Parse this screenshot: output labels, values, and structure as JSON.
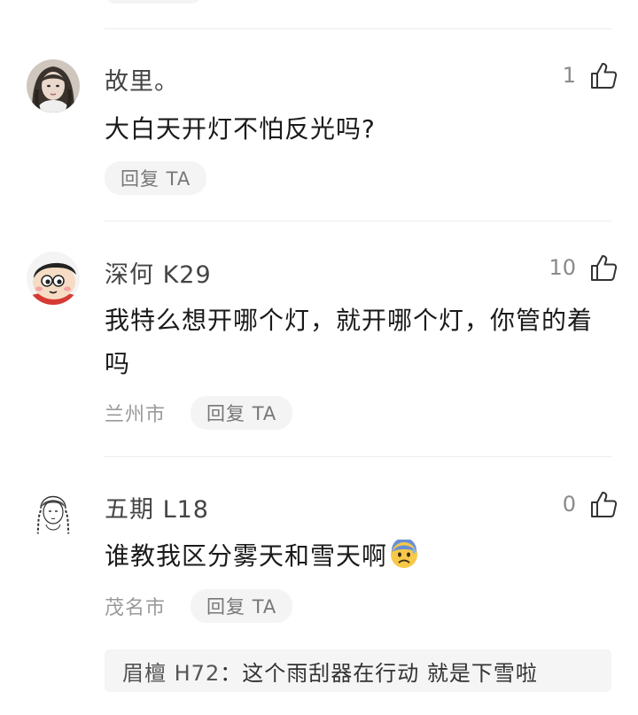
{
  "comments": [
    {
      "username": "故里。",
      "likes": "1",
      "text": "大白天开灯不怕反光吗?",
      "location": "",
      "reply_label": "回复 TA",
      "avatar": "girl-photo-avatar"
    },
    {
      "username": "深何 K29",
      "likes": "10",
      "text": "我特么想开哪个灯，就开哪个灯，你管的着吗",
      "location": "兰州市",
      "reply_label": "回复 TA",
      "avatar": "cartoon-boy-avatar"
    },
    {
      "username": "五期 L18",
      "likes": "0",
      "text": "谁教我区分雾天和雪天啊",
      "emoji": "anxious-sweat-face-emoji",
      "location": "茂名市",
      "reply_label": "回复 TA",
      "avatar": "sketch-girl-avatar"
    }
  ],
  "sub_reply": {
    "name": "眉檀 H72",
    "separator": "：",
    "text": "这个雨刮器在行动 就是下雪啦"
  },
  "icons": {
    "like": "thumbs-up-icon"
  },
  "colors": {
    "reply_bg": "#f4f4f4",
    "meta_text": "#9a9a9a",
    "username": "#444444"
  }
}
